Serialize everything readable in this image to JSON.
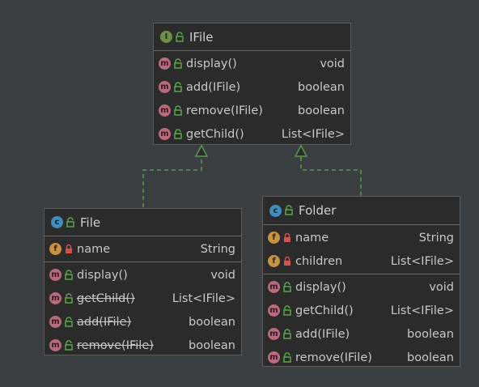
{
  "icons": {
    "interface": "I",
    "class": "c",
    "method": "m",
    "field": "f"
  },
  "classes": {
    "ifile": {
      "name": "IFile",
      "kind": "interface",
      "methods": [
        {
          "name": "display()",
          "type": "void"
        },
        {
          "name": "add(IFile)",
          "type": "boolean"
        },
        {
          "name": "remove(IFile)",
          "type": "boolean"
        },
        {
          "name": "getChild()",
          "type": "List<IFile>"
        }
      ]
    },
    "file": {
      "name": "File",
      "kind": "class",
      "fields": [
        {
          "name": "name",
          "type": "String"
        }
      ],
      "methods": [
        {
          "name": "display()",
          "type": "void"
        },
        {
          "name": "getChild()",
          "type": "List<IFile>",
          "deprecated": true
        },
        {
          "name": "add(IFile)",
          "type": "boolean",
          "deprecated": true
        },
        {
          "name": "remove(IFile)",
          "type": "boolean",
          "deprecated": true
        }
      ]
    },
    "folder": {
      "name": "Folder",
      "kind": "class",
      "fields": [
        {
          "name": "name",
          "type": "String"
        },
        {
          "name": "children",
          "type": "List<IFile>"
        }
      ],
      "methods": [
        {
          "name": "display()",
          "type": "void"
        },
        {
          "name": "getChild()",
          "type": "List<IFile>"
        },
        {
          "name": "add(IFile)",
          "type": "boolean"
        },
        {
          "name": "remove(IFile)",
          "type": "boolean"
        }
      ]
    }
  },
  "relations": [
    {
      "from": "File",
      "to": "IFile",
      "type": "realization"
    },
    {
      "from": "Folder",
      "to": "IFile",
      "type": "realization"
    }
  ],
  "colors": {
    "background": "#3c3f41",
    "box": "#2b2b2b",
    "relation_line": "#5a9a4a",
    "interface_badge": "#6d8f4a",
    "class_badge": "#3f8fc0",
    "method_badge": "#b86a7e",
    "field_badge": "#c89240",
    "public_lock": "#5aa84a",
    "private_lock": "#d0534f"
  }
}
